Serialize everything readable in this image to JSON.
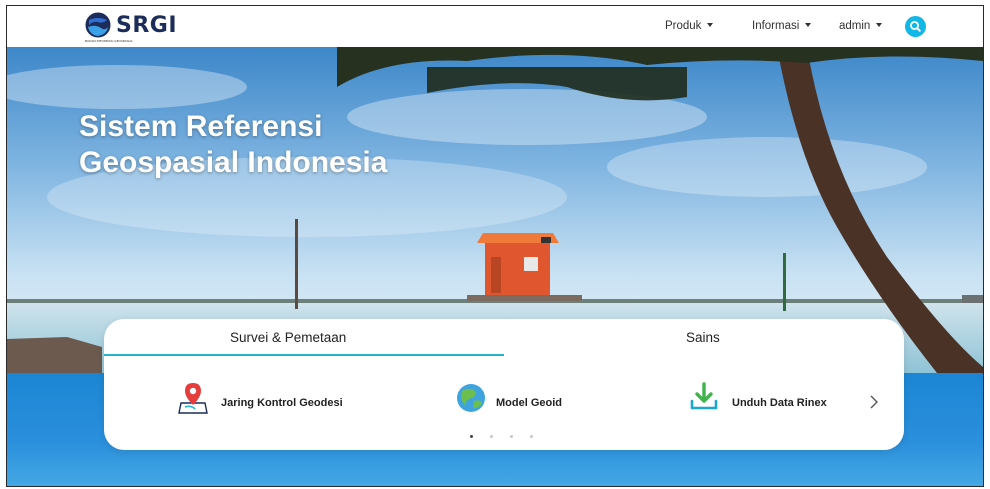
{
  "nav": {
    "logo_text": "SRGI",
    "logo_subtext": "BADAN INFORMASI GEOSPASIAL",
    "menu": [
      {
        "label": "Produk"
      },
      {
        "label": "Informasi"
      },
      {
        "label": "admin"
      }
    ],
    "search_icon": "search-icon"
  },
  "hero": {
    "title_line1": "Sistem Referensi",
    "title_line2": "Geospasial Indonesia"
  },
  "card": {
    "tabs": [
      {
        "label": "Survei & Pemetaan",
        "active": true
      },
      {
        "label": "Sains",
        "active": false
      }
    ],
    "items": [
      {
        "label": "Jaring Kontrol Geodesi",
        "icon": "map-pin-icon"
      },
      {
        "label": "Model Geoid",
        "icon": "globe-icon"
      },
      {
        "label": "Unduh Data Rinex",
        "icon": "download-icon"
      }
    ],
    "carousel": {
      "pages": 4,
      "active": 1
    }
  },
  "colors": {
    "accent": "#12b7e6",
    "tab_underline": "#23b4c8",
    "logo": "#1d2d5a",
    "sea": "#1c86d4"
  }
}
